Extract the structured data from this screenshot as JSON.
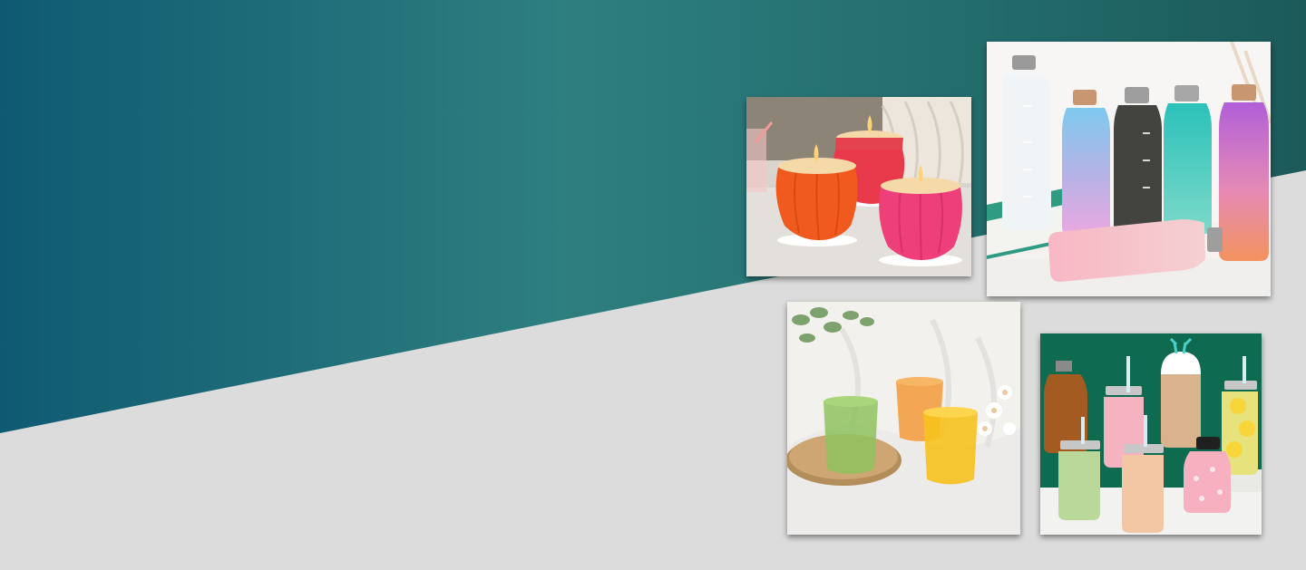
{
  "banner": {
    "photos": [
      {
        "id": "candles",
        "alt": ""
      },
      {
        "id": "bottles",
        "alt": ""
      },
      {
        "id": "glasses",
        "alt": ""
      },
      {
        "id": "jars",
        "alt": ""
      }
    ]
  },
  "colors": {
    "teal_dark": "#0f5a72",
    "teal_mid": "#2e7f80",
    "teal_right": "#1c5a5a",
    "background_gray": "#dcdcdc"
  }
}
